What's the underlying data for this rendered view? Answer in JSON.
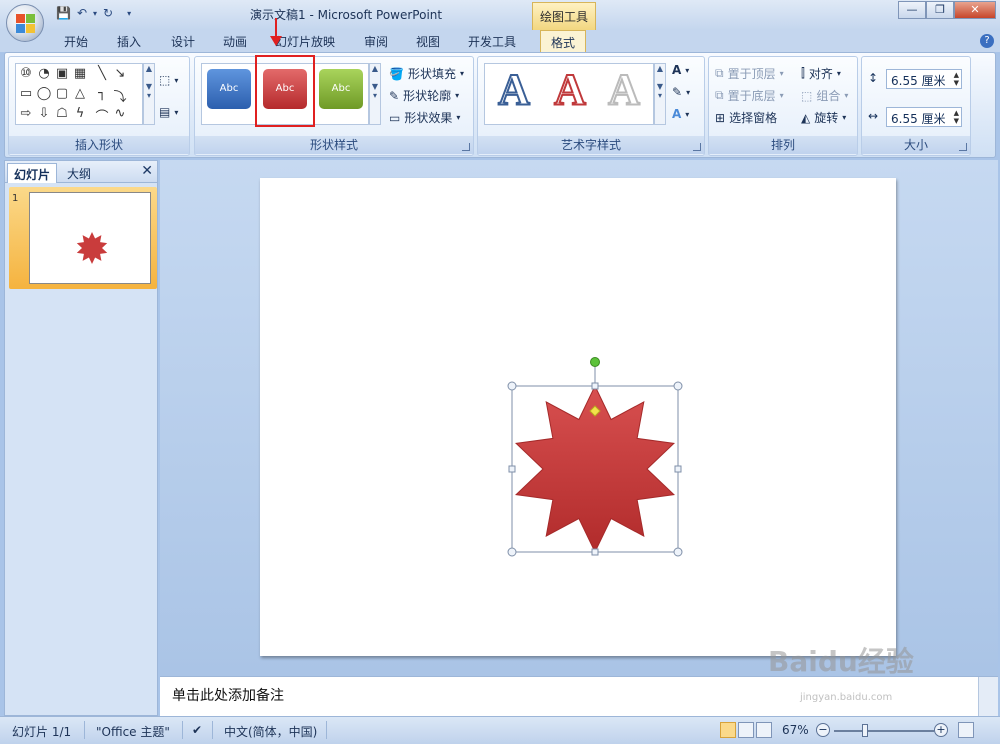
{
  "window": {
    "title": "演示文稿1 - Microsoft PowerPoint",
    "context_tab": "绘图工具"
  },
  "tabs": [
    {
      "label": "开始"
    },
    {
      "label": "插入"
    },
    {
      "label": "设计"
    },
    {
      "label": "动画"
    },
    {
      "label": "幻灯片放映"
    },
    {
      "label": "审阅"
    },
    {
      "label": "视图"
    },
    {
      "label": "开发工具"
    },
    {
      "label": "格式",
      "active": true
    }
  ],
  "ribbon": {
    "insert_shapes": {
      "label": "插入形状"
    },
    "shape_styles": {
      "label": "形状样式",
      "thumbs": [
        {
          "text": "Abc",
          "color": "#3b73c4"
        },
        {
          "text": "Abc",
          "color": "#c0393b",
          "selected": true
        },
        {
          "text": "Abc",
          "color": "#8cb83a"
        }
      ],
      "fill": "形状填充",
      "outline": "形状轮廓",
      "effects": "形状效果"
    },
    "wordart": {
      "label": "艺术字样式",
      "glyph": "A"
    },
    "arrange": {
      "label": "排列",
      "bring_front": "置于顶层",
      "send_back": "置于底层",
      "selection_pane": "选择窗格",
      "align": "对齐",
      "group": "组合",
      "rotate": "旋转"
    },
    "size": {
      "label": "大小",
      "height": "6.55 厘米",
      "width": "6.55 厘米"
    }
  },
  "left_pane": {
    "tab_slides": "幻灯片",
    "tab_outline": "大纲",
    "slide_number": "1"
  },
  "notes_placeholder": "单击此处添加备注",
  "status": {
    "slide": "幻灯片 1/1",
    "theme": "\"Office 主题\"",
    "language": "中文(简体，中国)",
    "zoom": "67%",
    "zoom_level": 0.67
  },
  "colors": {
    "star": "#c93c3c",
    "highlight": "#e02020",
    "handle_green": "#5cc23a",
    "handle_yellow": "#f2e24a"
  },
  "watermark": {
    "brand": "Baidu经验",
    "url": "jingyan.baidu.com"
  }
}
